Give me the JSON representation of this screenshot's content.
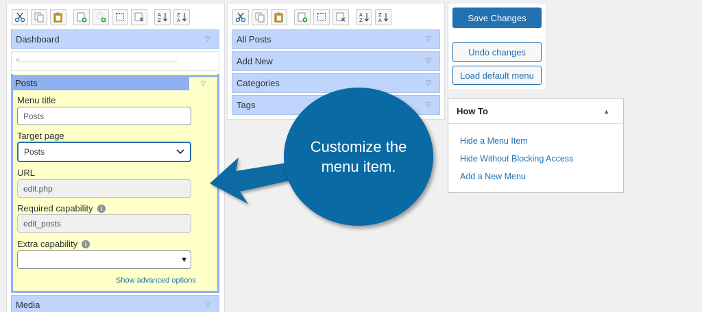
{
  "left_menu": {
    "items": [
      {
        "label": "Dashboard"
      },
      {
        "label": "Media"
      }
    ],
    "editor": {
      "title": "Posts",
      "fields": {
        "menu_title": {
          "label": "Menu title",
          "placeholder": "Posts"
        },
        "target_page": {
          "label": "Target page",
          "value": "Posts"
        },
        "url": {
          "label": "URL",
          "value": "edit.php"
        },
        "required_capability": {
          "label": "Required capability",
          "value": "edit_posts"
        },
        "extra_capability": {
          "label": "Extra capability",
          "value": ""
        }
      },
      "show_advanced": "Show advanced options"
    }
  },
  "submenu": {
    "items": [
      {
        "label": "All Posts"
      },
      {
        "label": "Add New"
      },
      {
        "label": "Categories"
      },
      {
        "label": "Tags"
      }
    ]
  },
  "actions": {
    "save": "Save Changes",
    "undo": "Undo changes",
    "load_default": "Load default menu"
  },
  "howto": {
    "title": "How To",
    "links": [
      "Hide a Menu Item",
      "Hide Without Blocking Access",
      "Add a New Menu"
    ]
  },
  "callout": {
    "text": "Customize the menu item."
  },
  "colors": {
    "accent": "#2271b1",
    "menu_item_bg": "#c0d5fc",
    "editor_bg": "#ffffc8",
    "callout_bg": "#0a6aa3"
  }
}
